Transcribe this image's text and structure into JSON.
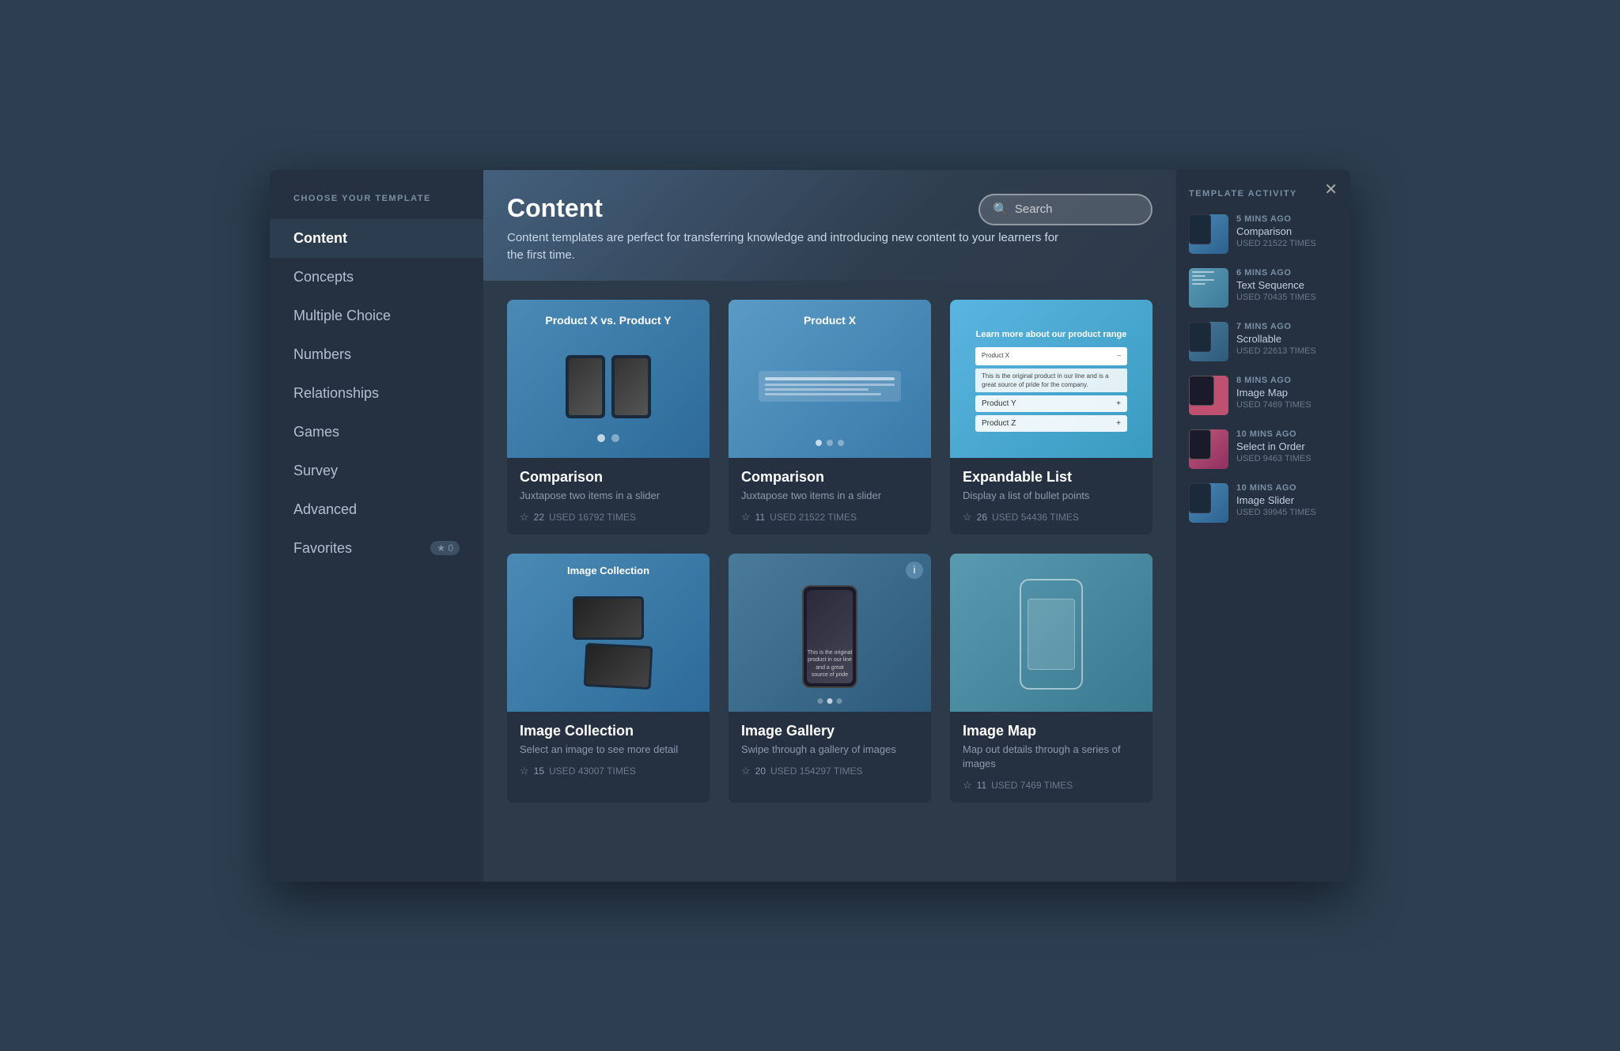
{
  "modal": {
    "close_label": "✕"
  },
  "sidebar": {
    "title": "CHOOSE YOUR TEMPLATE",
    "items": [
      {
        "id": "content",
        "label": "Content",
        "active": true
      },
      {
        "id": "concepts",
        "label": "Concepts",
        "active": false
      },
      {
        "id": "multiple-choice",
        "label": "Multiple Choice",
        "active": false
      },
      {
        "id": "numbers",
        "label": "Numbers",
        "active": false
      },
      {
        "id": "relationships",
        "label": "Relationships",
        "active": false
      },
      {
        "id": "games",
        "label": "Games",
        "active": false
      },
      {
        "id": "survey",
        "label": "Survey",
        "active": false
      },
      {
        "id": "advanced",
        "label": "Advanced",
        "active": false
      },
      {
        "id": "favorites",
        "label": "Favorites",
        "active": false,
        "badge": "★ 0"
      }
    ]
  },
  "main": {
    "title": "Content",
    "description": "Content templates are perfect for transferring knowledge and introducing new content to your learners for the first time.",
    "search_placeholder": "Search",
    "templates": [
      {
        "id": "comparison1",
        "name": "Comparison",
        "desc": "Juxtapose two items in a slider",
        "stars": 22,
        "used_count": "USED 16792 TIMES"
      },
      {
        "id": "comparison2",
        "name": "Comparison",
        "desc": "Juxtapose two items in a slider",
        "stars": 11,
        "used_count": "USED 21522 TIMES"
      },
      {
        "id": "expandable",
        "name": "Expandable List",
        "desc": "Display a list of bullet points",
        "stars": 26,
        "used_count": "USED 54436 TIMES"
      },
      {
        "id": "imgcollection",
        "name": "Image Collection",
        "desc": "Select an image to see more detail",
        "stars": 15,
        "used_count": "USED 43007 TIMES"
      },
      {
        "id": "imggallery",
        "name": "Image Gallery",
        "desc": "Swipe through a gallery of images",
        "stars": 20,
        "used_count": "USED 154297 TIMES"
      },
      {
        "id": "imgmap",
        "name": "Image Map",
        "desc": "Map out details through a series of images",
        "stars": 11,
        "used_count": "USED 7469 TIMES"
      }
    ],
    "expandable_title": "Learn more about our product range",
    "expandable_items": [
      "Product X",
      "Product Y",
      "Product Z"
    ],
    "thumb_labels": {
      "comparison1": "Product X vs. Product Y",
      "comparison2": "Product X",
      "imgcollection": "Image Collection"
    }
  },
  "right_panel": {
    "title": "TEMPLATE ACTIVITY",
    "items": [
      {
        "time": "5 MINS AGO",
        "name": "Comparison",
        "used": "USED 21522 TIMES",
        "thumb_type": "1"
      },
      {
        "time": "6 MINS AGO",
        "name": "Text Sequence",
        "used": "USED 70435 TIMES",
        "thumb_type": "2"
      },
      {
        "time": "7 MINS AGO",
        "name": "Scrollable",
        "used": "USED 22613 TIMES",
        "thumb_type": "3"
      },
      {
        "time": "8 MINS AGO",
        "name": "Image Map",
        "used": "USED 7469 TIMES",
        "thumb_type": "4"
      },
      {
        "time": "10 MINS AGO",
        "name": "Select in Order",
        "used": "USED 9463 TIMES",
        "thumb_type": "4b"
      },
      {
        "time": "10 MINS AGO",
        "name": "Image Slider",
        "used": "USED 39945 TIMES",
        "thumb_type": "5"
      }
    ]
  }
}
